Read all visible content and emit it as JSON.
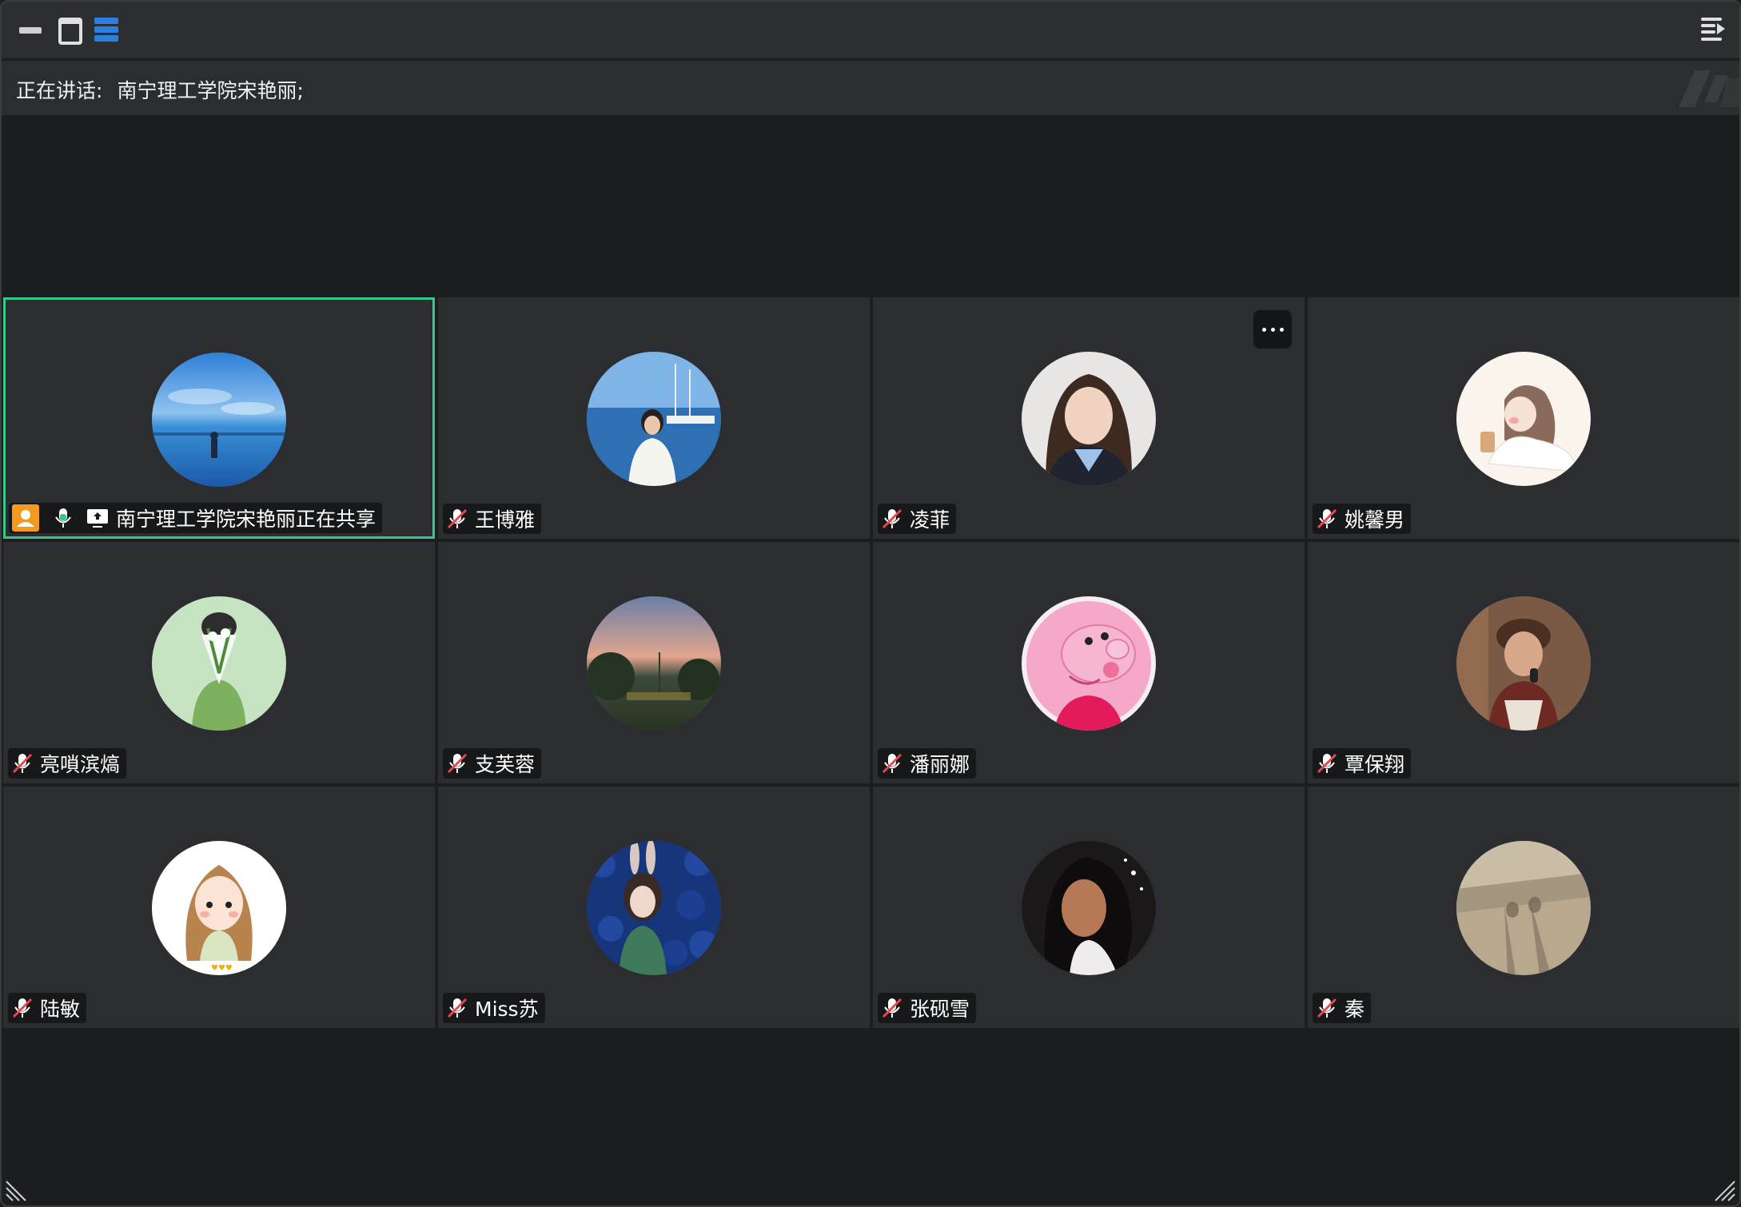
{
  "window": {
    "minimize_icon": "minimize-icon",
    "maximize_icon": "maximize-icon",
    "layout_icon": "layout-list-icon",
    "menu_icon": "sidebar-menu-icon",
    "accent": "#2b7fe0"
  },
  "speaker_bar": {
    "label": "正在讲话:",
    "speaker": "南宁理工学院宋艳丽;"
  },
  "participants": [
    {
      "name": "南宁理工学院宋艳丽正在共享",
      "muted": false,
      "host": true,
      "sharing": true,
      "active": true,
      "avatar": "sea-horizon"
    },
    {
      "name": "王博雅",
      "muted": true,
      "avatar": "harbor-portrait"
    },
    {
      "name": "凌菲",
      "muted": true,
      "more": true,
      "avatar": "woman-portrait"
    },
    {
      "name": "姚馨男",
      "muted": true,
      "avatar": "drawn-girl-tea"
    },
    {
      "name": "亮嗩滨熇",
      "muted": true,
      "avatar": "boy-flowers"
    },
    {
      "name": "支芙蓉",
      "muted": true,
      "avatar": "sunset-trees"
    },
    {
      "name": "潘丽娜",
      "muted": true,
      "avatar": "pink-pig"
    },
    {
      "name": "覃保翔",
      "muted": true,
      "avatar": "singer"
    },
    {
      "name": "陆敏",
      "muted": true,
      "avatar": "braided-girl"
    },
    {
      "name": "Miss苏",
      "muted": true,
      "avatar": "bunny-doll"
    },
    {
      "name": "张砚雪",
      "muted": true,
      "avatar": "curly-hair-woman"
    },
    {
      "name": "秦",
      "muted": true,
      "avatar": "shadow-street"
    }
  ],
  "colors": {
    "active_border": "#34c88a",
    "host_badge": "#f39a1e",
    "tile_bg": "#2b2d30",
    "mic_off": "#e5484d"
  }
}
